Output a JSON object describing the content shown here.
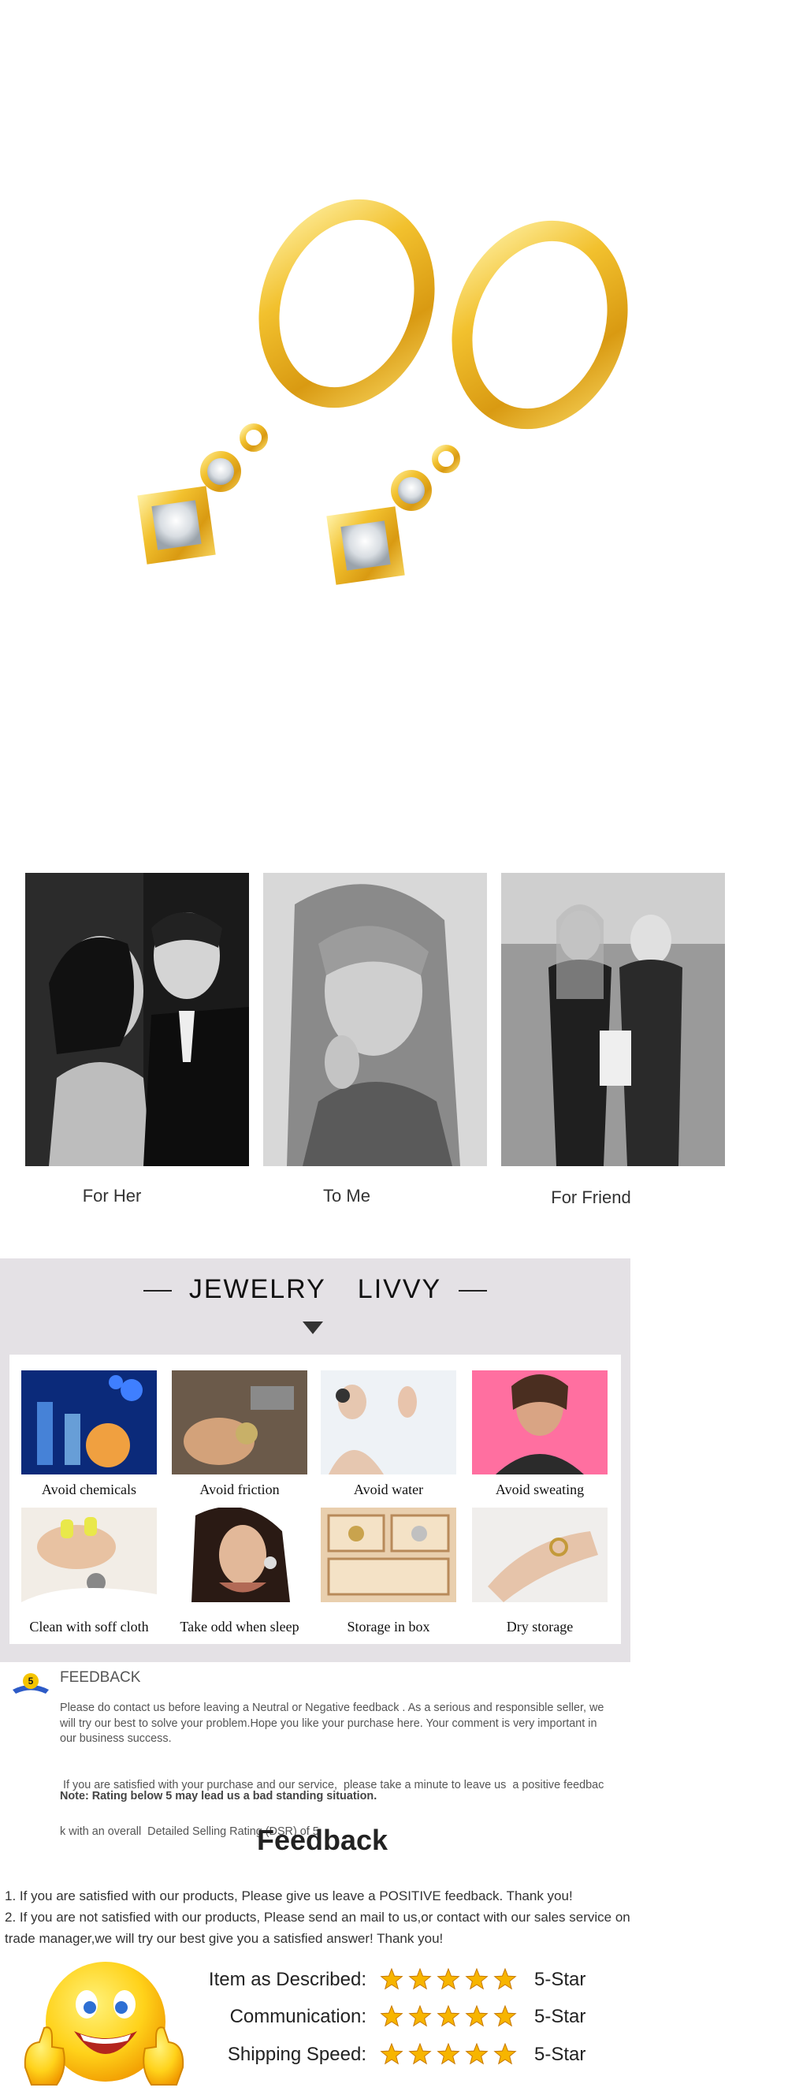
{
  "product": {
    "image_name": "gold-hoop-earrings-with-crystal-charms"
  },
  "gifts": [
    {
      "label": "For Her"
    },
    {
      "label": "To Me"
    },
    {
      "label": "For Friend"
    }
  ],
  "brand": {
    "left": "JEWELRY",
    "right": "LIVVY"
  },
  "care_tips": [
    {
      "label": "Avoid chemicals"
    },
    {
      "label": "Avoid friction"
    },
    {
      "label": "Avoid water"
    },
    {
      "label": "Avoid sweating"
    },
    {
      "label": "Clean with soff cloth"
    },
    {
      "label": "Take odd when sleep"
    },
    {
      "label": "Storage in box"
    },
    {
      "label": "Dry storage"
    }
  ],
  "feedback_notice": {
    "heading": "FEEDBACK",
    "badge": "5",
    "para1_lines": [
      "Please do contact us before leaving a Neutral or Negative  feedback . As a serious and responsible seller, we",
      "will try our best to solve your problem.Hope you like your purchase here. Your comment is very important in",
      "our business success."
    ],
    "para2_lines": [
      " If you are satisfied with your purchase and our service,  please take a minute to leave us  a positive feedbac",
      "k with an overall  Detailed Selling Rating (DSR) of 5"
    ],
    "note": "Note: Rating below 5 may lead us a bad standing situation."
  },
  "feedback": {
    "title": "Feedback",
    "lines": [
      "1. If you are satisfied with our products, Please give us leave a POSITIVE feedback. Thank you!",
      "2. If you are not satisfied with our products, Please send an mail to us,or contact with our sales service on",
      "trade manager,we will try our best give you a satisfied answer! Thank you!"
    ]
  },
  "ratings": [
    {
      "label": "Item as Described:",
      "stars": 5,
      "value": "5-Star"
    },
    {
      "label": "Communication:",
      "stars": 5,
      "value": "5-Star"
    },
    {
      "label": "Shipping Speed:",
      "stars": 5,
      "value": "5-Star"
    }
  ],
  "colors": {
    "gold": "#f2c12e",
    "star": "#f7b500",
    "panel": "#e4e1e5"
  }
}
